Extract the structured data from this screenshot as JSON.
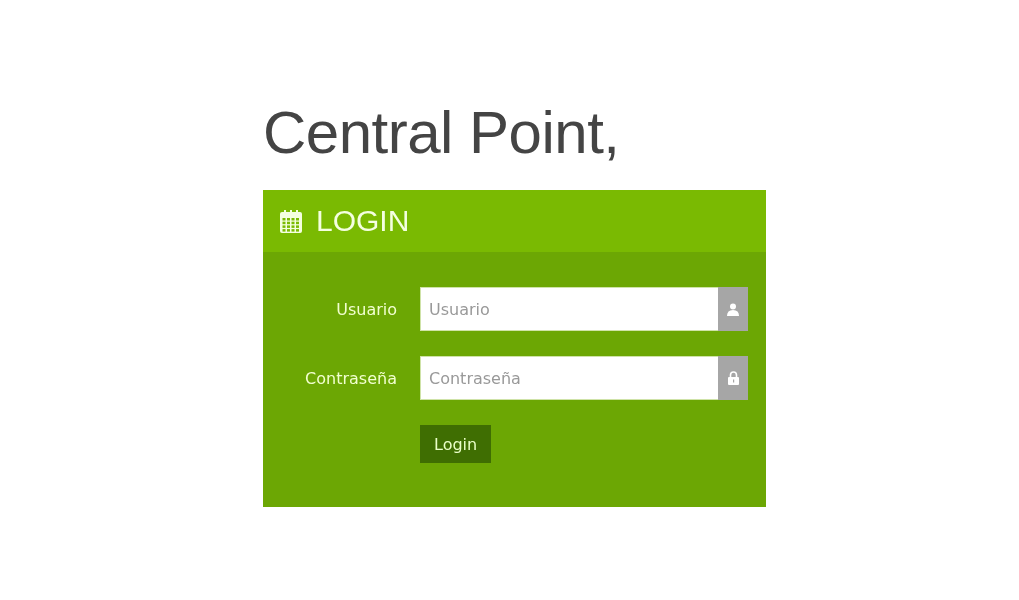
{
  "heading": "Central Point,",
  "panel": {
    "title": "LOGIN",
    "fields": [
      {
        "label": "Usuario",
        "placeholder": "Usuario",
        "kind": "user"
      },
      {
        "label": "Contraseña",
        "placeholder": "Contraseña",
        "kind": "lock"
      }
    ],
    "button": "Login"
  }
}
